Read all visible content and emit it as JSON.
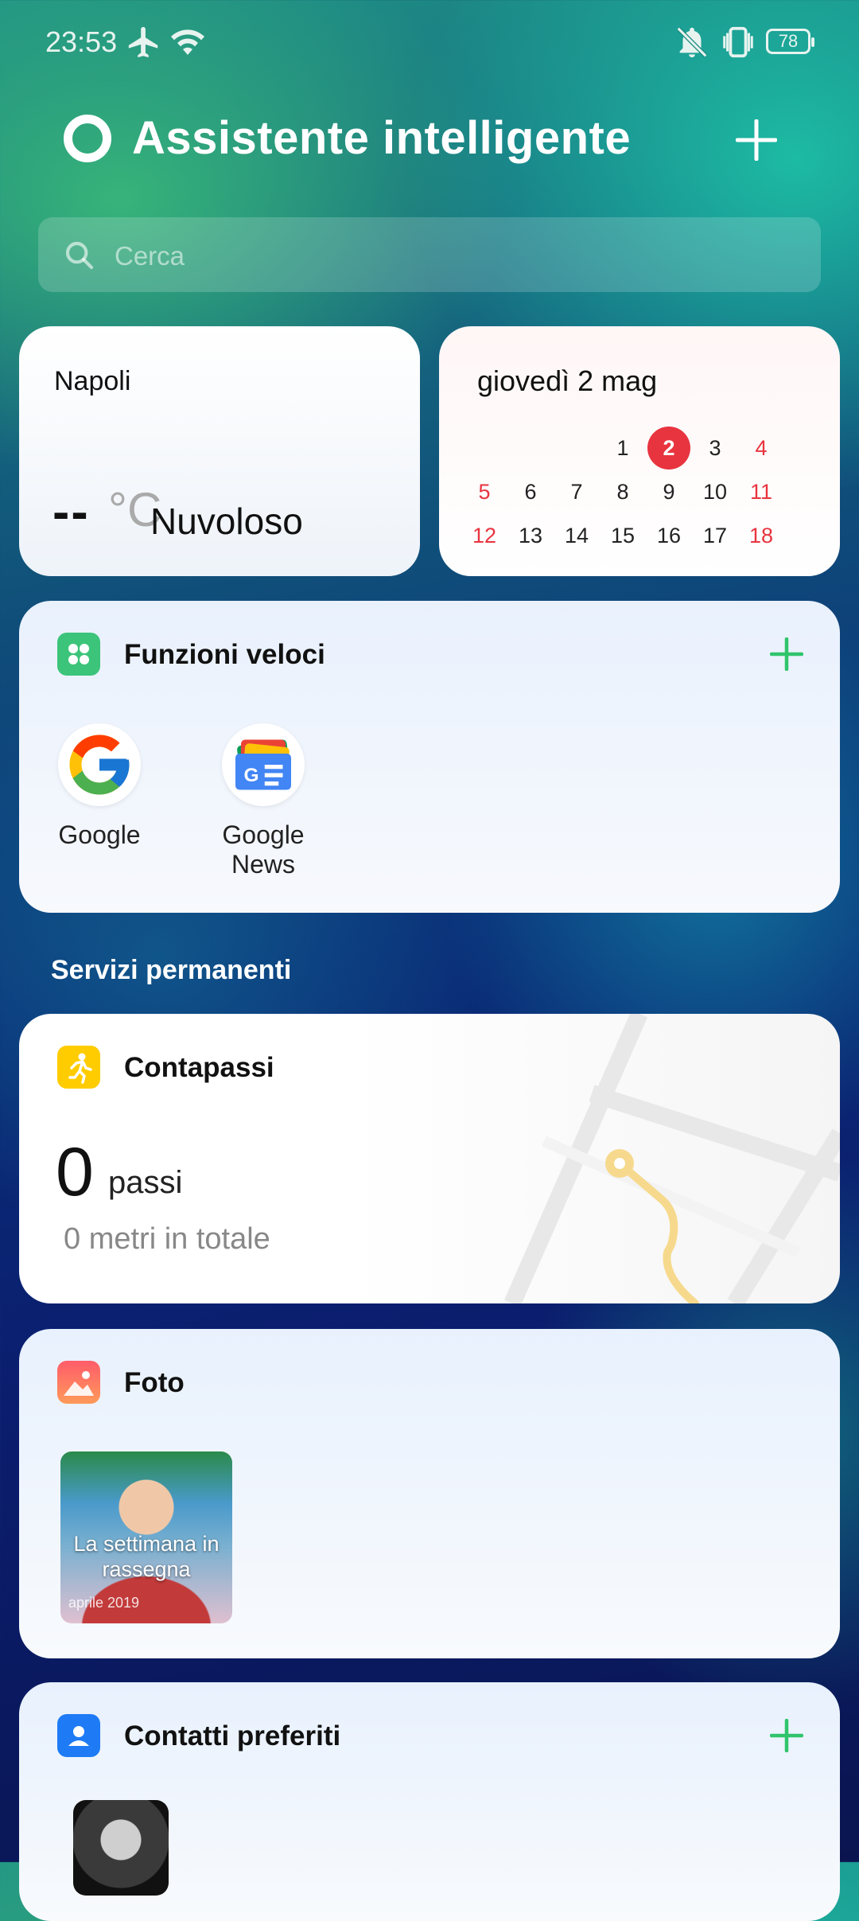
{
  "status": {
    "time": "23:53",
    "battery": "78"
  },
  "header": {
    "title": "Assistente intelligente"
  },
  "search": {
    "placeholder": "Cerca"
  },
  "weather": {
    "city": "Napoli",
    "temp": "--",
    "unit": "°C",
    "condition": "Nuvoloso"
  },
  "calendar": {
    "title": "giovedì 2 mag",
    "rows": [
      [
        "",
        "",
        "",
        "1",
        "2",
        "3",
        "4"
      ],
      [
        "5",
        "6",
        "7",
        "8",
        "9",
        "10",
        "11"
      ],
      [
        "12",
        "13",
        "14",
        "15",
        "16",
        "17",
        "18"
      ]
    ],
    "today": "2"
  },
  "quick": {
    "title": "Funzioni veloci",
    "apps": [
      {
        "label": "Google"
      },
      {
        "label": "Google News"
      }
    ]
  },
  "permanent": {
    "label": "Servizi permanenti"
  },
  "steps": {
    "title": "Contapassi",
    "value": "0",
    "unit": "passi",
    "total": "0 metri in totale"
  },
  "photos": {
    "title": "Foto",
    "album_caption": "La settimana in rassegna",
    "album_date": "aprile 2019"
  },
  "contacts": {
    "title": "Contatti preferiti"
  },
  "colors": {
    "accent_green": "#2fc46b",
    "today_red": "#e8343f",
    "weekend_red": "#e8343f"
  }
}
